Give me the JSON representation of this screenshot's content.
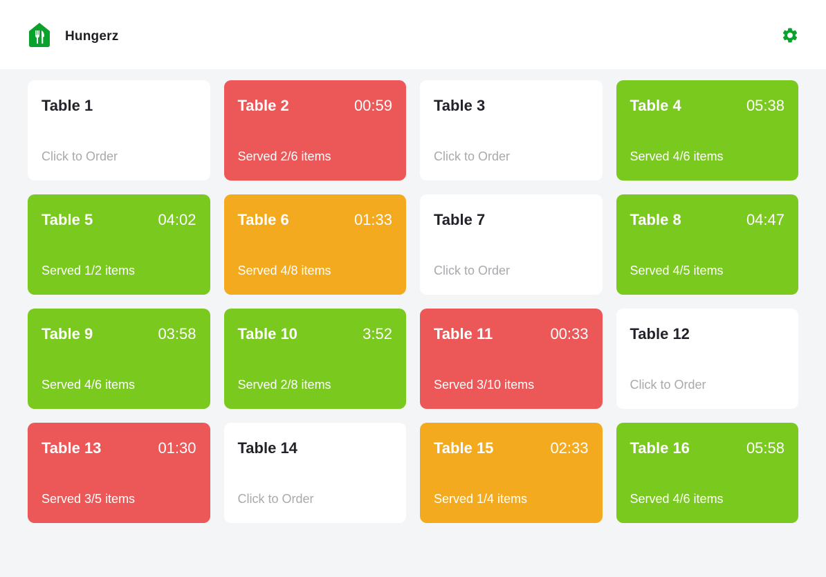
{
  "app": {
    "name": "Hungerz",
    "logo_icon": "restaurant-house-icon",
    "settings_icon": "gear-icon",
    "brand_color": "#0aa12c"
  },
  "status_colors": {
    "green": "#7ac91f",
    "red": "#ec5757",
    "orange": "#f3aa1f",
    "idle": "#ffffff"
  },
  "tables": [
    {
      "name": "Table 1",
      "timer": "",
      "status": "Click to Order",
      "state": "idle"
    },
    {
      "name": "Table 2",
      "timer": "00:59",
      "status": "Served 2/6 items",
      "state": "red"
    },
    {
      "name": "Table 3",
      "timer": "",
      "status": "Click to Order",
      "state": "idle"
    },
    {
      "name": "Table 4",
      "timer": "05:38",
      "status": "Served 4/6 items",
      "state": "green"
    },
    {
      "name": "Table 5",
      "timer": "04:02",
      "status": "Served 1/2 items",
      "state": "green"
    },
    {
      "name": "Table 6",
      "timer": "01:33",
      "status": "Served 4/8 items",
      "state": "orange"
    },
    {
      "name": "Table 7",
      "timer": "",
      "status": "Click to Order",
      "state": "idle"
    },
    {
      "name": "Table 8",
      "timer": "04:47",
      "status": "Served 4/5 items",
      "state": "green"
    },
    {
      "name": "Table 9",
      "timer": "03:58",
      "status": "Served 4/6 items",
      "state": "green"
    },
    {
      "name": "Table 10",
      "timer": "3:52",
      "status": "Served 2/8 items",
      "state": "green"
    },
    {
      "name": "Table 11",
      "timer": "00:33",
      "status": "Served 3/10 items",
      "state": "red"
    },
    {
      "name": "Table 12",
      "timer": "",
      "status": "Click to Order",
      "state": "idle"
    },
    {
      "name": "Table 13",
      "timer": "01:30",
      "status": "Served 3/5 items",
      "state": "red"
    },
    {
      "name": "Table 14",
      "timer": "",
      "status": "Click to Order",
      "state": "idle"
    },
    {
      "name": "Table 15",
      "timer": "02:33",
      "status": "Served 1/4 items",
      "state": "orange"
    },
    {
      "name": "Table 16",
      "timer": "05:58",
      "status": "Served 4/6 items",
      "state": "green"
    }
  ]
}
